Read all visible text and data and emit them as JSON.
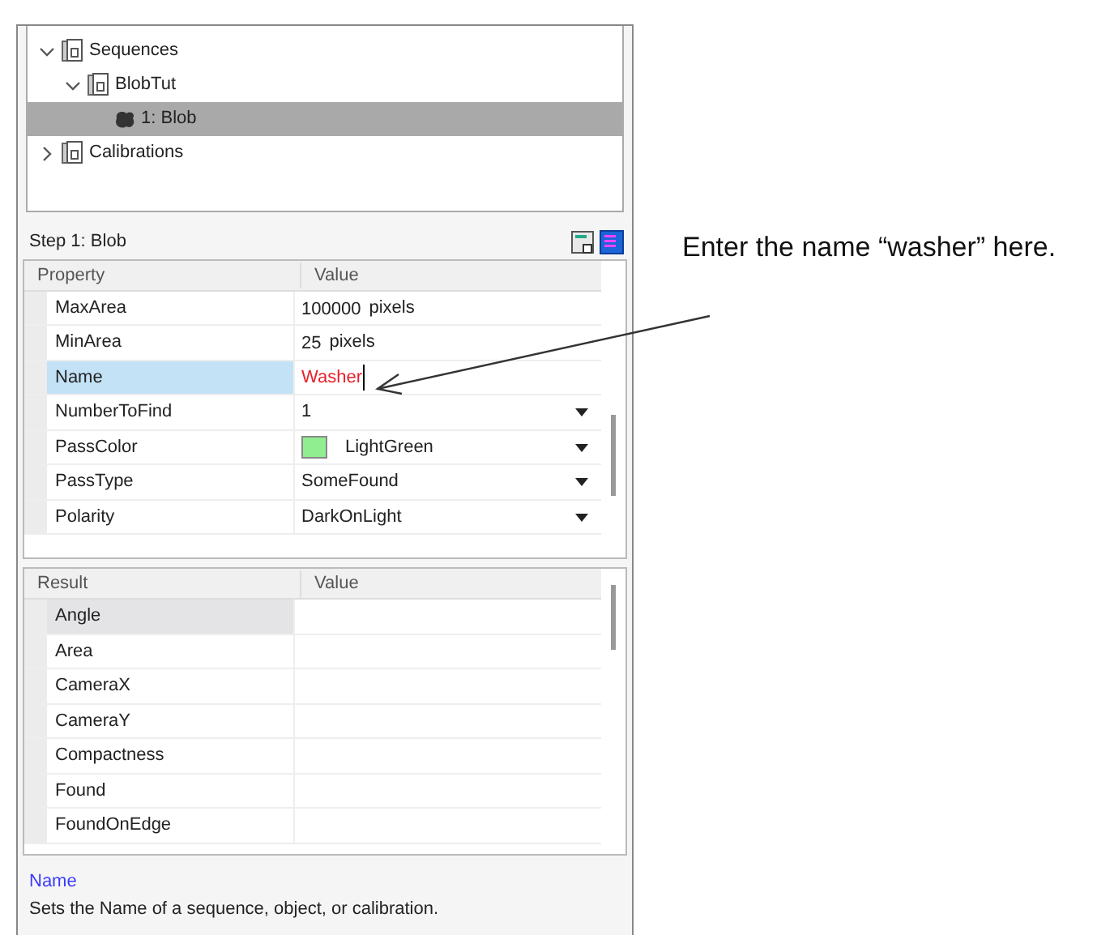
{
  "tree": [
    {
      "label": "Sequences",
      "expanded": true,
      "selected": false,
      "children": [
        {
          "label": "BlobTut",
          "expanded": true,
          "selected": false,
          "children": [
            {
              "label": "1: Blob",
              "selected": true,
              "kind": "step"
            }
          ]
        }
      ]
    },
    {
      "label": "Calibrations",
      "expanded": false,
      "selected": false
    }
  ],
  "step_title": "Step 1: Blob",
  "property_grid": {
    "columns": [
      "Property",
      "Value"
    ],
    "rows": [
      {
        "name": "MaxArea",
        "kind": "number",
        "value": "100000",
        "unit": "pixels",
        "selected": false
      },
      {
        "name": "MinArea",
        "kind": "number",
        "value": "25",
        "unit": "pixels",
        "selected": false
      },
      {
        "name": "Name",
        "kind": "edit",
        "value": "Washer",
        "selected": true
      },
      {
        "name": "NumberToFind",
        "kind": "dropdown",
        "value": "1",
        "selected": false
      },
      {
        "name": "PassColor",
        "kind": "color",
        "value": "LightGreen",
        "color": "#90ee90",
        "selected": false
      },
      {
        "name": "PassType",
        "kind": "dropdown",
        "value": "SomeFound",
        "selected": false
      },
      {
        "name": "Polarity",
        "kind": "dropdown",
        "value": "DarkOnLight",
        "selected": false
      }
    ]
  },
  "result_grid": {
    "columns": [
      "Result",
      "Value"
    ],
    "rows": [
      {
        "name": "Angle",
        "selected": true
      },
      {
        "name": "Area",
        "selected": false
      },
      {
        "name": "CameraX",
        "selected": false
      },
      {
        "name": "CameraY",
        "selected": false
      },
      {
        "name": "Compactness",
        "selected": false
      },
      {
        "name": "Found",
        "selected": false
      },
      {
        "name": "FoundOnEdge",
        "selected": false
      }
    ]
  },
  "description": {
    "title": "Name",
    "text": "Sets the Name of a sequence, object, or calibration."
  },
  "annotation": "Enter the name “washer” here."
}
